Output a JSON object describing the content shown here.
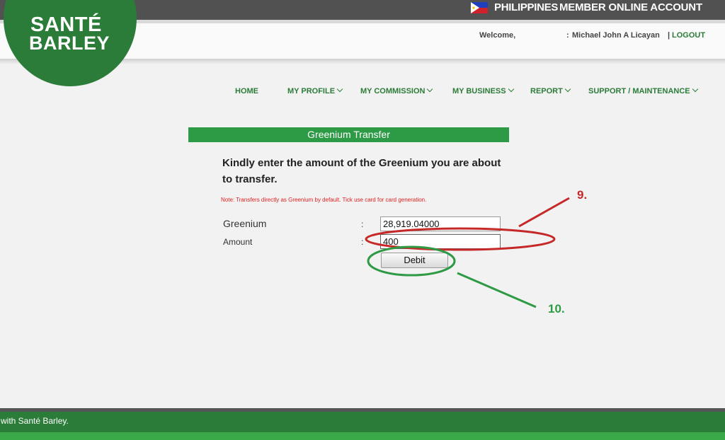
{
  "header": {
    "country": "PHILIPPINES",
    "account_label": "MEMBER ONLINE ACCOUNT",
    "welcome": "Welcome,",
    "user_colon": ":",
    "username": "Michael John A Licayan",
    "separator": "|",
    "logout": "LOGOUT"
  },
  "logo": {
    "line1": "SANTÉ",
    "line2": "BARLEY"
  },
  "nav": {
    "items": [
      {
        "label": "HOME",
        "dropdown": false
      },
      {
        "label": "MY PROFILE",
        "dropdown": true
      },
      {
        "label": "MY COMMISSION",
        "dropdown": true
      },
      {
        "label": "MY BUSINESS",
        "dropdown": true
      },
      {
        "label": "REPORT",
        "dropdown": true
      },
      {
        "label": "SUPPORT / MAINTENANCE",
        "dropdown": true
      }
    ]
  },
  "form": {
    "title": "Greenium Transfer",
    "instruction": "Kindly enter the amount of the Greenium you are about to transfer.",
    "note": "Note: Transfers directly as Greenium by default. Tick use card for card generation.",
    "greenium_label": "Greenium",
    "greenium_value": "28,919.04000",
    "amount_label": "Amount",
    "amount_value": "400",
    "colon": ":",
    "debit_label": "Debit"
  },
  "annotations": {
    "step_9": "9.",
    "step_10": "10.",
    "red": "#c62828",
    "green": "#2e9a44"
  },
  "footer": {
    "text": "with Santé Barley."
  },
  "colors": {
    "brand_green": "#2b7c38",
    "title_green": "#2d9a46",
    "topbar": "#515151",
    "note_red": "#e02020"
  }
}
